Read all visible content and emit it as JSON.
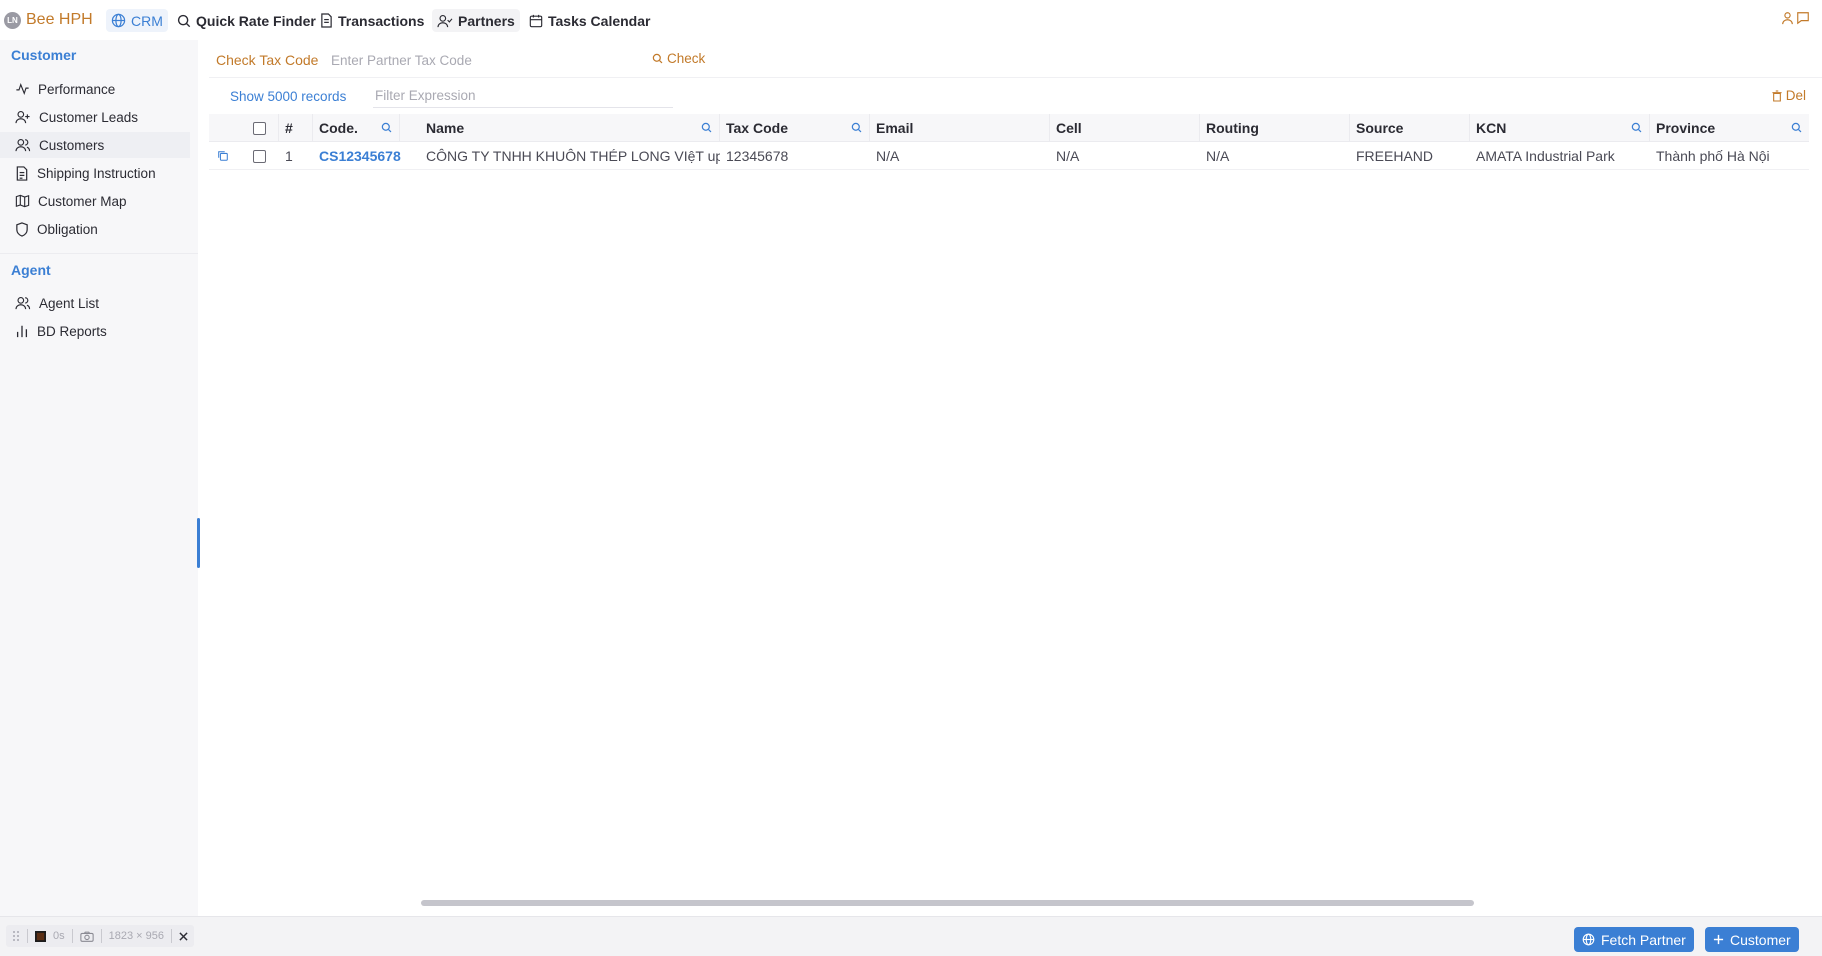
{
  "brand": {
    "logo_text": "LN",
    "name": "Bee HPH"
  },
  "nav": [
    {
      "label": "CRM",
      "icon": "globe-icon",
      "state": "current"
    },
    {
      "label": "Quick Rate Finder",
      "icon": "search-icon"
    },
    {
      "label": "Transactions",
      "icon": "document-icon"
    },
    {
      "label": "Partners",
      "icon": "user-check-icon",
      "state": "selected"
    },
    {
      "label": "Tasks Calendar",
      "icon": "calendar-icon"
    }
  ],
  "sidebar": {
    "customer_title": "Customer",
    "customer_items": [
      {
        "label": "Performance",
        "icon": "activity-icon"
      },
      {
        "label": "Customer Leads",
        "icon": "user-plus-icon"
      },
      {
        "label": "Customers",
        "icon": "users-icon",
        "active": true
      },
      {
        "label": "Shipping Instruction",
        "icon": "file-text-icon"
      },
      {
        "label": "Customer Map",
        "icon": "map-icon"
      },
      {
        "label": "Obligation",
        "icon": "shield-icon"
      }
    ],
    "agent_title": "Agent",
    "agent_items": [
      {
        "label": "Agent List",
        "icon": "users-icon"
      },
      {
        "label": "BD Reports",
        "icon": "bar-chart-icon"
      }
    ]
  },
  "tax_check": {
    "label": "Check Tax Code",
    "placeholder": "Enter Partner Tax Code",
    "value": "",
    "button": "Check"
  },
  "records": {
    "show_label": "Show 5000 records",
    "filter_placeholder": "Filter Expression",
    "filter_value": "",
    "delete_label": "Del"
  },
  "table": {
    "columns": {
      "index": "#",
      "code": "Code.",
      "name": "Name",
      "tax_code": "Tax Code",
      "email": "Email",
      "cell": "Cell",
      "routing": "Routing",
      "source": "Source",
      "kcn": "KCN",
      "province": "Province"
    },
    "rows": [
      {
        "index": "1",
        "code": "CS12345678",
        "name": "CÔNG TY TNHH KHUÔN THÉP LONG VIệT up",
        "tax_code": "12345678",
        "email": "N/A",
        "cell": "N/A",
        "routing": "N/A",
        "source": "FREEHAND",
        "kcn": "AMATA Industrial Park",
        "province": "Thành phố Hà Nội"
      }
    ]
  },
  "devtools": {
    "duration": "0s",
    "size": "1823 × 956"
  },
  "footer": {
    "fetch_label": "Fetch Partner",
    "add_label": "Customer"
  },
  "colors": {
    "accent": "#3b7fd4",
    "brand": "#c27a2a",
    "sidebar_bg": "#f7f7f9",
    "text": "#2b2b33"
  }
}
